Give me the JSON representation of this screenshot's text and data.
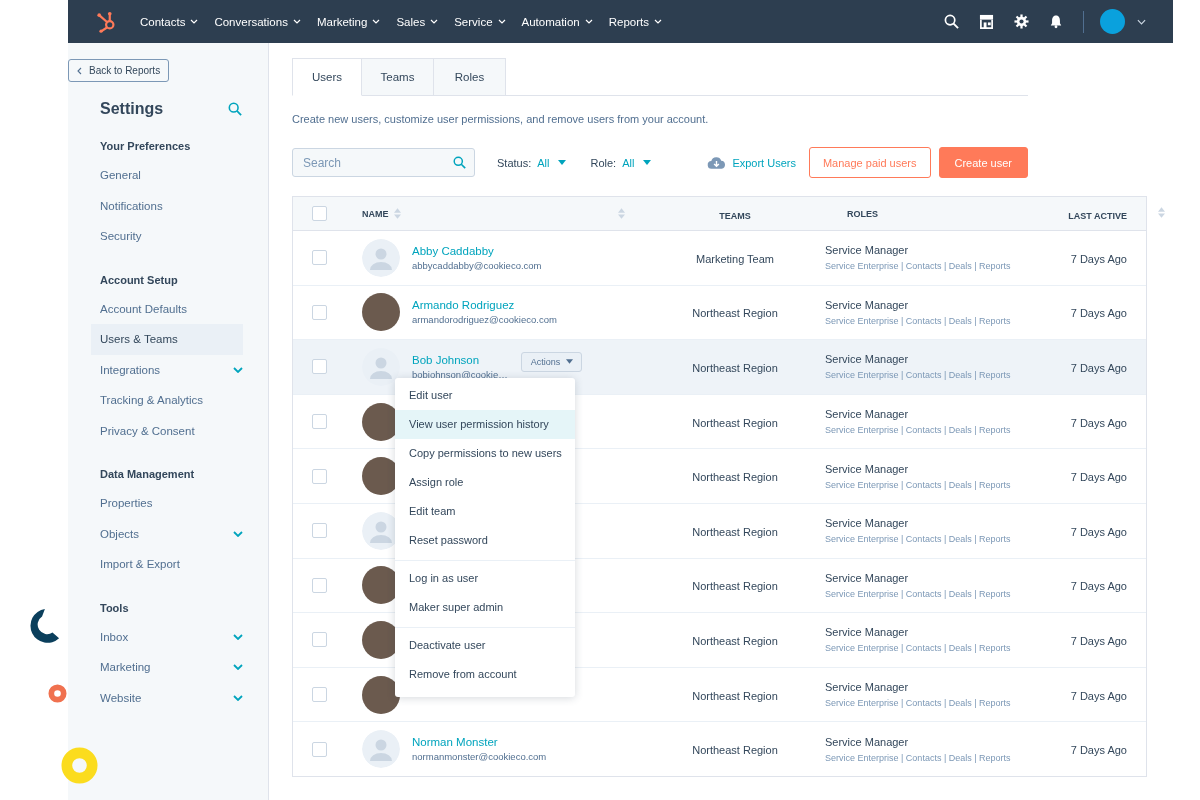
{
  "nav": {
    "items": [
      {
        "label": "Contacts"
      },
      {
        "label": "Conversations"
      },
      {
        "label": "Marketing"
      },
      {
        "label": "Sales"
      },
      {
        "label": "Service"
      },
      {
        "label": "Automation"
      },
      {
        "label": "Reports"
      }
    ]
  },
  "sidebar": {
    "back_button": "Back to Reports",
    "title": "Settings",
    "sections": [
      {
        "heading": "Your Preferences",
        "items": [
          {
            "label": "General",
            "selected": false,
            "expandable": false
          },
          {
            "label": "Notifications",
            "selected": false,
            "expandable": false
          },
          {
            "label": "Security",
            "selected": false,
            "expandable": false
          }
        ]
      },
      {
        "heading": "Account Setup",
        "items": [
          {
            "label": "Account Defaults",
            "selected": false,
            "expandable": false
          },
          {
            "label": "Users & Teams",
            "selected": true,
            "expandable": false
          },
          {
            "label": "Integrations",
            "selected": false,
            "expandable": true
          },
          {
            "label": "Tracking & Analytics",
            "selected": false,
            "expandable": false
          },
          {
            "label": "Privacy & Consent",
            "selected": false,
            "expandable": false
          }
        ]
      },
      {
        "heading": "Data Management",
        "items": [
          {
            "label": "Properties",
            "selected": false,
            "expandable": false
          },
          {
            "label": "Objects",
            "selected": false,
            "expandable": true
          },
          {
            "label": "Import & Export",
            "selected": false,
            "expandable": false
          }
        ]
      },
      {
        "heading": "Tools",
        "items": [
          {
            "label": "Inbox",
            "selected": false,
            "expandable": true
          },
          {
            "label": "Marketing",
            "selected": false,
            "expandable": true
          },
          {
            "label": "Website",
            "selected": false,
            "expandable": true
          }
        ]
      }
    ]
  },
  "tabs": [
    {
      "label": "Users",
      "selected": true
    },
    {
      "label": "Teams",
      "selected": false
    },
    {
      "label": "Roles",
      "selected": false
    }
  ],
  "description": "Create new users, customize user permissions, and remove users from your account.",
  "search": {
    "placeholder": "Search"
  },
  "filters": [
    {
      "label": "Status:",
      "value": "All"
    },
    {
      "label": "Role:",
      "value": "All"
    }
  ],
  "export_button": "Export Users",
  "manage_button": "Manage paid users",
  "create_button": "Create user",
  "table": {
    "select_all_checked": false,
    "columns": [
      "NAME",
      "TEAMS",
      "ROLES",
      "LAST ACTIVE"
    ],
    "rows": [
      {
        "checked": false,
        "highlighted": false,
        "kind": "default",
        "name": "Abby Caddabby",
        "email": "abbycaddabby@cookieco.com",
        "team": "Marketing Team",
        "role": "Service Manager",
        "permissions": "Service Enterprise | Contacts | Deals | Reports",
        "last_active": "7 Days Ago"
      },
      {
        "checked": false,
        "highlighted": false,
        "kind": "photo",
        "name": "Armando Rodriguez",
        "email": "armandorodriguez@cookieco.com",
        "team": "Northeast Region",
        "role": "Service Manager",
        "permissions": "Service Enterprise | Contacts | Deals | Reports",
        "last_active": "7 Days Ago"
      },
      {
        "checked": false,
        "highlighted": true,
        "kind": "default",
        "name": "Bob Johnson",
        "email": "bobjohnson@cookie…",
        "actions": "Actions",
        "team": "Northeast Region",
        "role": "Service Manager",
        "permissions": "Service Enterprise | Contacts | Deals | Reports",
        "last_active": "7 Days Ago"
      },
      {
        "checked": false,
        "highlighted": false,
        "kind": "photo",
        "team": "Northeast Region",
        "role": "Service Manager",
        "permissions": "Service Enterprise | Contacts | Deals | Reports",
        "last_active": "7 Days Ago"
      },
      {
        "checked": false,
        "highlighted": false,
        "kind": "photo",
        "team": "Northeast Region",
        "role": "Service Manager",
        "permissions": "Service Enterprise | Contacts | Deals | Reports",
        "last_active": "7 Days Ago"
      },
      {
        "checked": false,
        "highlighted": false,
        "kind": "default",
        "team": "Northeast Region",
        "role": "Service Manager",
        "permissions": "Service Enterprise | Contacts | Deals | Reports",
        "last_active": "7 Days Ago"
      },
      {
        "checked": false,
        "highlighted": false,
        "kind": "photo",
        "team": "Northeast Region",
        "role": "Service Manager",
        "permissions": "Service Enterprise | Contacts | Deals | Reports",
        "last_active": "7 Days Ago"
      },
      {
        "checked": false,
        "highlighted": false,
        "kind": "photo",
        "team": "Northeast Region",
        "role": "Service Manager",
        "permissions": "Service Enterprise | Contacts | Deals | Reports",
        "last_active": "7 Days Ago"
      },
      {
        "checked": false,
        "highlighted": false,
        "kind": "photo",
        "team": "Northeast Region",
        "role": "Service Manager",
        "permissions": "Service Enterprise | Contacts | Deals | Reports",
        "last_active": "7 Days Ago"
      },
      {
        "checked": false,
        "highlighted": false,
        "kind": "default",
        "name": "Norman Monster",
        "email": "normanmonster@cookieco.com",
        "team": "Northeast Region",
        "role": "Service Manager",
        "permissions": "Service Enterprise | Contacts | Deals | Reports",
        "last_active": "7 Days Ago"
      }
    ]
  },
  "actions_menu": {
    "groups": [
      [
        {
          "label": "Edit user",
          "selected": false
        },
        {
          "label": "View user permission history",
          "selected": true
        },
        {
          "label": "Copy permissions to new users",
          "selected": false
        },
        {
          "label": "Assign role",
          "selected": false
        },
        {
          "label": "Edit team",
          "selected": false
        },
        {
          "label": "Reset password",
          "selected": false
        }
      ],
      [
        {
          "label": "Log in as user",
          "selected": false
        },
        {
          "label": "Maker super admin",
          "selected": false
        }
      ],
      [
        {
          "label": "Deactivate user",
          "selected": false
        },
        {
          "label": "Remove from account",
          "selected": false
        }
      ]
    ]
  }
}
